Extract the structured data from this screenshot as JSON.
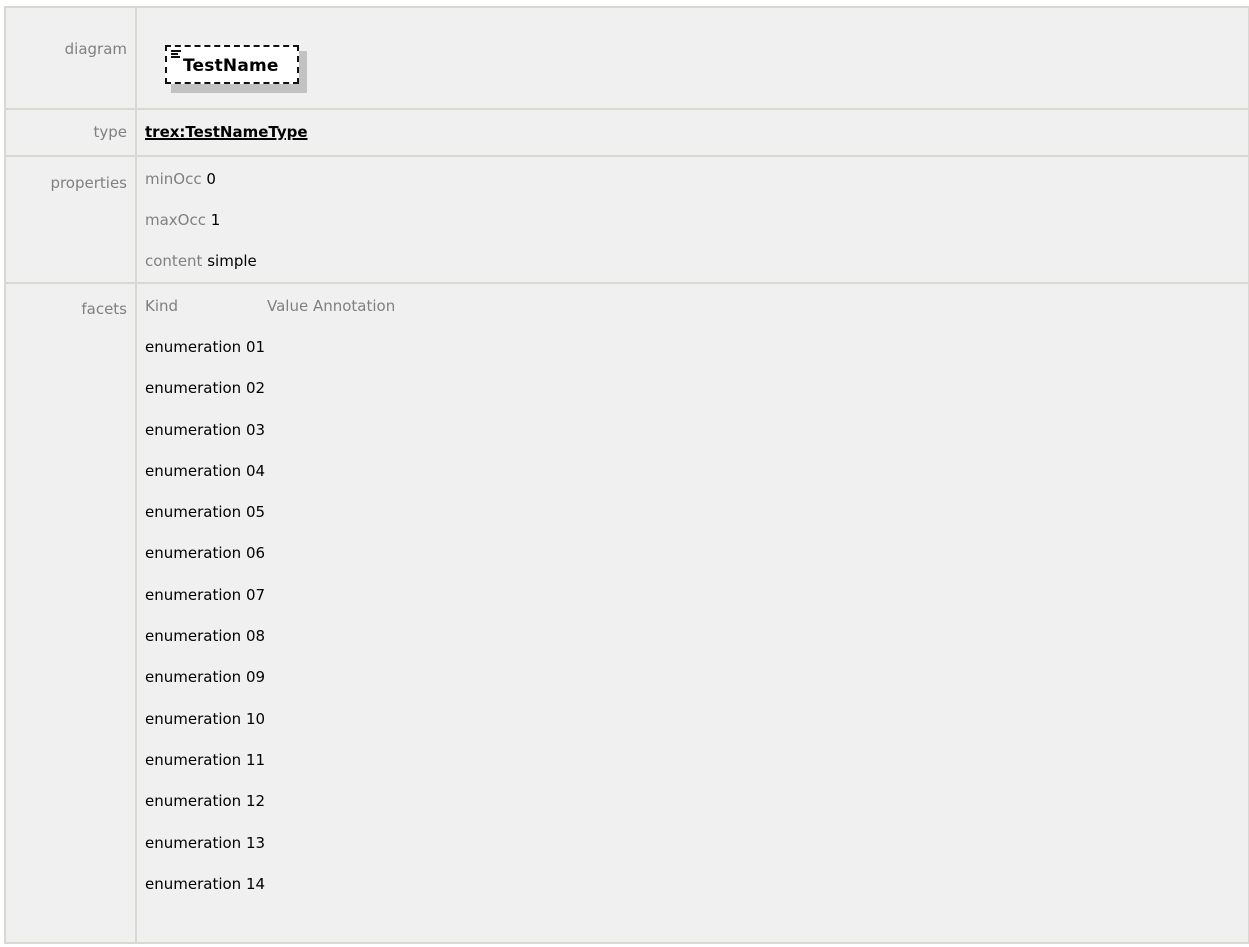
{
  "rows": {
    "diagram": {
      "label": "diagram",
      "element_name": "TestName"
    },
    "type": {
      "label": "type",
      "value": "trex:TestNameType"
    },
    "properties": {
      "label": "properties",
      "items": [
        {
          "key": "minOcc",
          "value": "0"
        },
        {
          "key": "maxOcc",
          "value": "1"
        },
        {
          "key": "content",
          "value": "simple"
        }
      ]
    },
    "facets": {
      "label": "facets",
      "headers": {
        "kind": "Kind",
        "value_annotation": "Value Annotation"
      },
      "items": [
        {
          "kind": "enumeration",
          "value": "01"
        },
        {
          "kind": "enumeration",
          "value": "02"
        },
        {
          "kind": "enumeration",
          "value": "03"
        },
        {
          "kind": "enumeration",
          "value": "04"
        },
        {
          "kind": "enumeration",
          "value": "05"
        },
        {
          "kind": "enumeration",
          "value": "06"
        },
        {
          "kind": "enumeration",
          "value": "07"
        },
        {
          "kind": "enumeration",
          "value": "08"
        },
        {
          "kind": "enumeration",
          "value": "09"
        },
        {
          "kind": "enumeration",
          "value": "10"
        },
        {
          "kind": "enumeration",
          "value": "11"
        },
        {
          "kind": "enumeration",
          "value": "12"
        },
        {
          "kind": "enumeration",
          "value": "13"
        },
        {
          "kind": "enumeration",
          "value": "14"
        }
      ]
    }
  }
}
